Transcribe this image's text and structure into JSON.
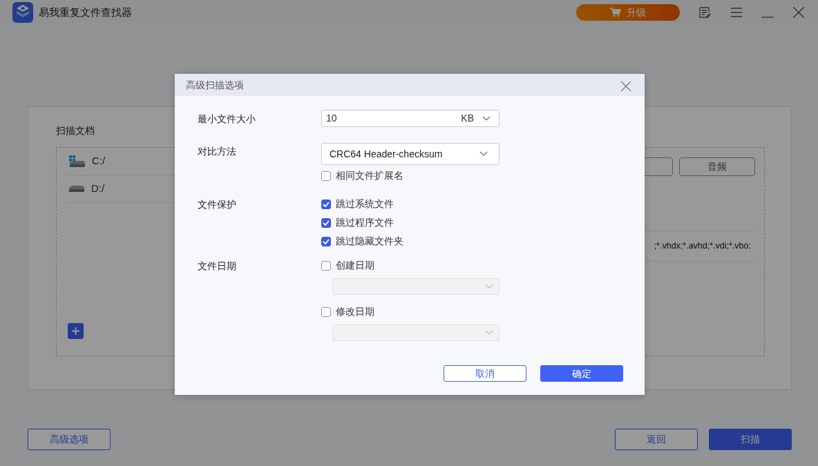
{
  "app": {
    "title": "易我重复文件查找器",
    "upgrade_label": "升级"
  },
  "page": {
    "section_label": "扫描文档",
    "drives": [
      {
        "label": "C:/",
        "kind": "system"
      },
      {
        "label": "D:/",
        "kind": "disk"
      }
    ],
    "type_buttons": [
      "音频"
    ],
    "extensions_text": ";*.vhdx;*.avhd;*.vdi;*.vbo:"
  },
  "footer": {
    "advanced": "高级选项",
    "back": "返回",
    "scan": "扫描"
  },
  "dialog": {
    "title": "高级扫描选项",
    "min_size": {
      "label": "最小文件大小",
      "value": "10",
      "unit": "KB"
    },
    "compare": {
      "label": "对比方法",
      "value": "CRC64 Header-checksum",
      "option": {
        "label": "相同文件扩展名",
        "checked": false
      }
    },
    "protection": {
      "label": "文件保护",
      "options": [
        {
          "label": "跳过系统文件",
          "checked": true
        },
        {
          "label": "跳过程序文件",
          "checked": true
        },
        {
          "label": "跳过隐藏文件夹",
          "checked": true
        }
      ]
    },
    "dates": {
      "label": "文件日期",
      "options": [
        {
          "label": "创建日期",
          "checked": false
        },
        {
          "label": "修改日期",
          "checked": false
        }
      ]
    },
    "cancel": "取消",
    "ok": "确定"
  }
}
